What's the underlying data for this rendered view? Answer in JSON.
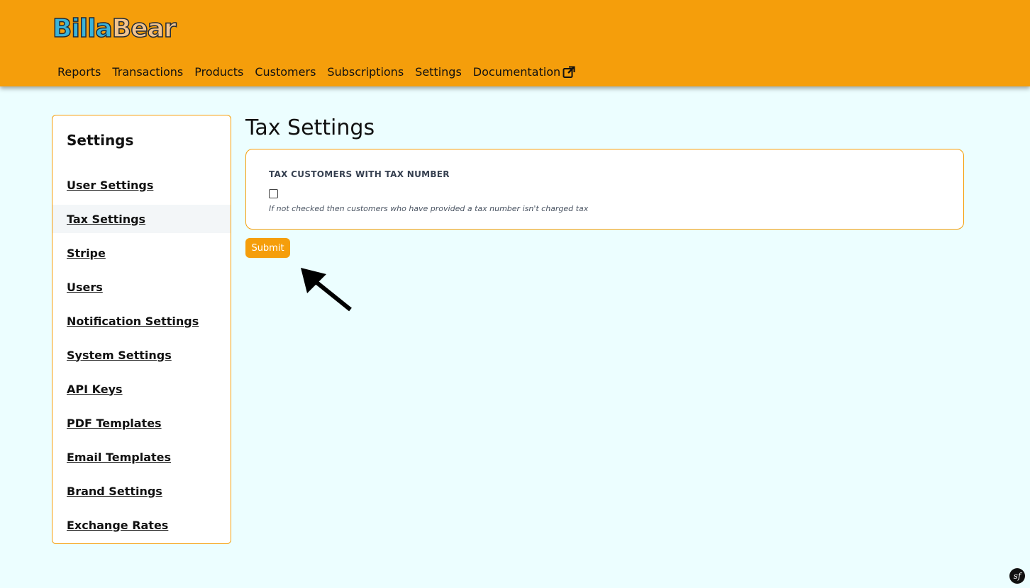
{
  "header": {
    "logo_part1": "Billa",
    "logo_part2": "Bear",
    "nav": [
      {
        "label": "Reports"
      },
      {
        "label": "Transactions"
      },
      {
        "label": "Products"
      },
      {
        "label": "Customers"
      },
      {
        "label": "Subscriptions"
      },
      {
        "label": "Settings"
      },
      {
        "label": "Documentation",
        "icon": "external-link-icon"
      }
    ]
  },
  "sidebar": {
    "title": "Settings",
    "items": [
      {
        "label": "User Settings"
      },
      {
        "label": "Tax Settings",
        "active": true
      },
      {
        "label": "Stripe"
      },
      {
        "label": "Users"
      },
      {
        "label": "Notification Settings"
      },
      {
        "label": "System Settings"
      },
      {
        "label": "API Keys"
      },
      {
        "label": "PDF Templates"
      },
      {
        "label": "Email Templates"
      },
      {
        "label": "Brand Settings"
      },
      {
        "label": "Exchange Rates"
      }
    ]
  },
  "main": {
    "title": "Tax Settings",
    "field_label": "TAX CUSTOMERS WITH TAX NUMBER",
    "checkbox_checked": false,
    "help_text": "If not checked then customers who have provided a tax number isn't charged tax",
    "submit_label": "Submit"
  },
  "colors": {
    "accent": "#f59e0b",
    "background": "#ecfeff"
  },
  "footer": {
    "debug_icon": "symfony-icon",
    "debug_text": "sf"
  }
}
